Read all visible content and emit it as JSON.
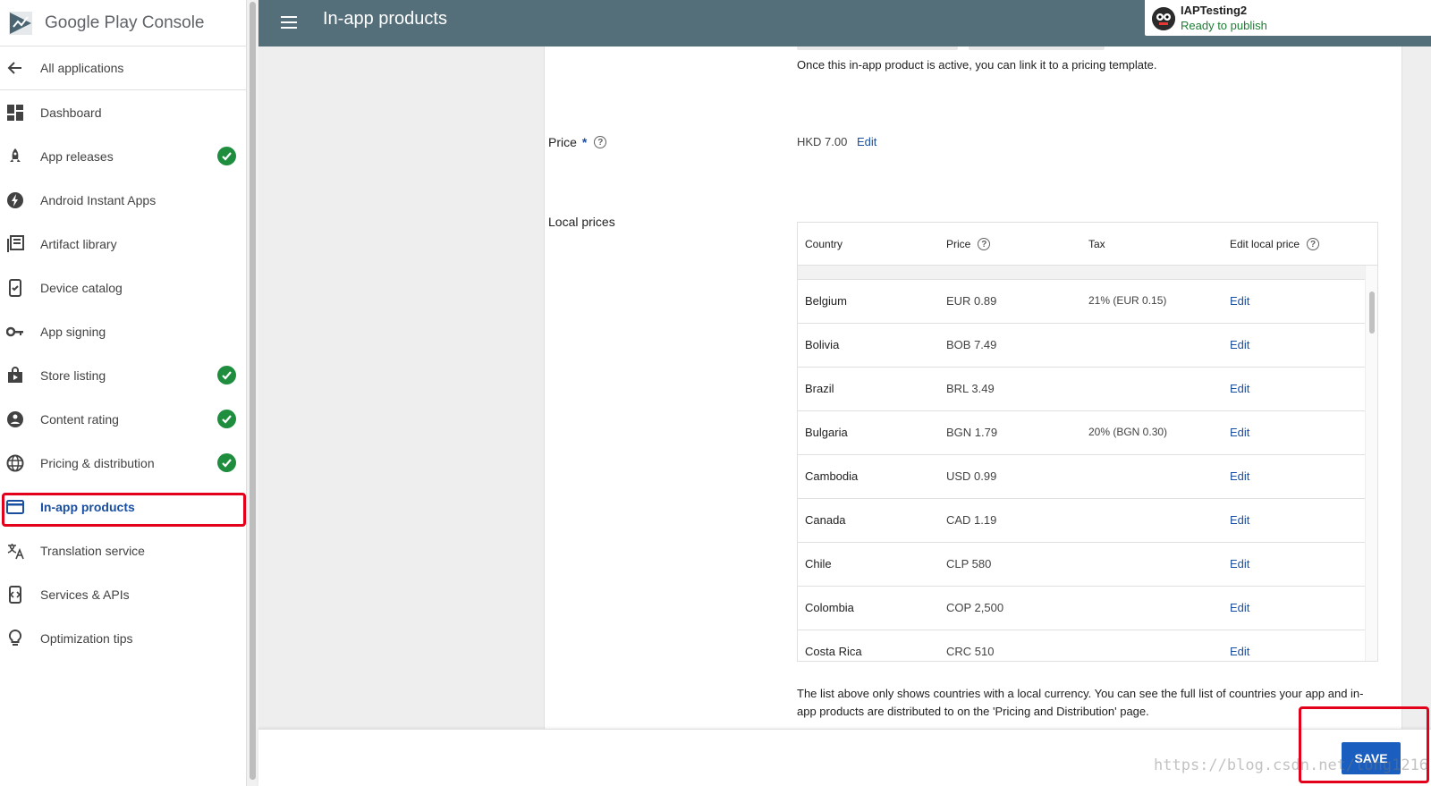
{
  "app": {
    "logo_text": "Google Play Console"
  },
  "colors": {
    "header_bg": "#546e7a",
    "accent": "#1a4fa0",
    "check": "#1e8e3e",
    "highlight": "#e3001b",
    "save_button": "#1a5ec0"
  },
  "sidebar": {
    "all_apps": "All applications",
    "items": [
      {
        "label": "Dashboard",
        "icon": "dashboard-icon",
        "checked": false
      },
      {
        "label": "App releases",
        "icon": "rocket-icon",
        "checked": true
      },
      {
        "label": "Android Instant Apps",
        "icon": "bolt-icon",
        "checked": false
      },
      {
        "label": "Artifact library",
        "icon": "library-icon",
        "checked": false
      },
      {
        "label": "Device catalog",
        "icon": "device-icon",
        "checked": false
      },
      {
        "label": "App signing",
        "icon": "key-icon",
        "checked": false
      },
      {
        "label": "Store listing",
        "icon": "store-icon",
        "checked": true
      },
      {
        "label": "Content rating",
        "icon": "rating-icon",
        "checked": true
      },
      {
        "label": "Pricing & distribution",
        "icon": "globe-icon",
        "checked": true
      },
      {
        "label": "In-app products",
        "icon": "card-icon",
        "checked": false,
        "active": true
      },
      {
        "label": "Translation service",
        "icon": "translate-icon",
        "checked": false
      },
      {
        "label": "Services & APIs",
        "icon": "api-icon",
        "checked": false
      },
      {
        "label": "Optimization tips",
        "icon": "bulb-icon",
        "checked": false
      }
    ]
  },
  "header": {
    "title": "In-app products"
  },
  "app_chip": {
    "name": "IAPTesting2",
    "status": "Ready to publish"
  },
  "main": {
    "template_note": "Once this in-app product is active, you can link it to a pricing template.",
    "price_label": "Price",
    "price_required": "*",
    "price_value": "HKD 7.00",
    "price_edit": "Edit",
    "local_prices_label": "Local prices",
    "table": {
      "headers": [
        "Country",
        "Price",
        "Tax",
        "Edit local price"
      ],
      "rows": [
        {
          "country": "Belgium",
          "price": "EUR 0.89",
          "tax": "21% (EUR 0.15)",
          "edit": "Edit"
        },
        {
          "country": "Bolivia",
          "price": "BOB 7.49",
          "tax": "",
          "edit": "Edit"
        },
        {
          "country": "Brazil",
          "price": "BRL 3.49",
          "tax": "",
          "edit": "Edit"
        },
        {
          "country": "Bulgaria",
          "price": "BGN 1.79",
          "tax": "20% (BGN 0.30)",
          "edit": "Edit"
        },
        {
          "country": "Cambodia",
          "price": "USD 0.99",
          "tax": "",
          "edit": "Edit"
        },
        {
          "country": "Canada",
          "price": "CAD 1.19",
          "tax": "",
          "edit": "Edit"
        },
        {
          "country": "Chile",
          "price": "CLP 580",
          "tax": "",
          "edit": "Edit"
        },
        {
          "country": "Colombia",
          "price": "COP 2,500",
          "tax": "",
          "edit": "Edit"
        },
        {
          "country": "Costa Rica",
          "price": "CRC 510",
          "tax": "",
          "edit": "Edit"
        }
      ]
    },
    "footer_note": "The list above only shows countries with a local currency. You can see the full list of countries your app and in-app products are distributed to on the 'Pricing and Distribution' page."
  },
  "save_label": "SAVE",
  "watermark": "https://blog.csdn.net/long1216"
}
